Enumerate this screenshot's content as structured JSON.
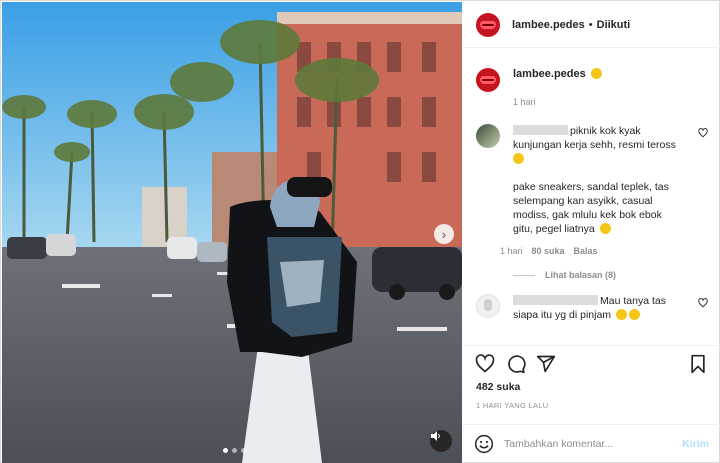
{
  "post": {
    "username": "lambee.pedes",
    "follow_status": "Diikuti",
    "caption_time": "1 hari"
  },
  "comments": [
    {
      "text_line1": "piknik kok kyak",
      "text_line2": "kunjungan kerja sehh, resmi teross",
      "text_line3": "pake sneakers, sandal teplek, tas",
      "text_line4": "selempang kan asyikk, casual",
      "text_line5": "modiss, gak mlulu kek bok ebok",
      "text_line6": "gitu, pegel liatnya",
      "time": "1 hari",
      "likes": "80 suka",
      "reply": "Balas",
      "view_replies": "Lihat balasan (8)"
    },
    {
      "text_line1": "Mau tanya tas",
      "text_line2": "siapa itu yg di pinjam"
    }
  ],
  "likes_count": "482 suka",
  "post_date": "1 HARI YANG LALU",
  "composer": {
    "placeholder": "Tambahkan komentar...",
    "post_label": "Kirim"
  },
  "icons": {
    "like": "heart-icon",
    "comment": "comment-icon",
    "share": "paper-plane-icon",
    "save": "bookmark-icon",
    "emoji": "smiley-icon",
    "sound": "speaker-icon",
    "next": "chevron-right-icon"
  },
  "colors": {
    "brand_avatar": "#c51320",
    "post_button_disabled": "#b2dffc"
  }
}
